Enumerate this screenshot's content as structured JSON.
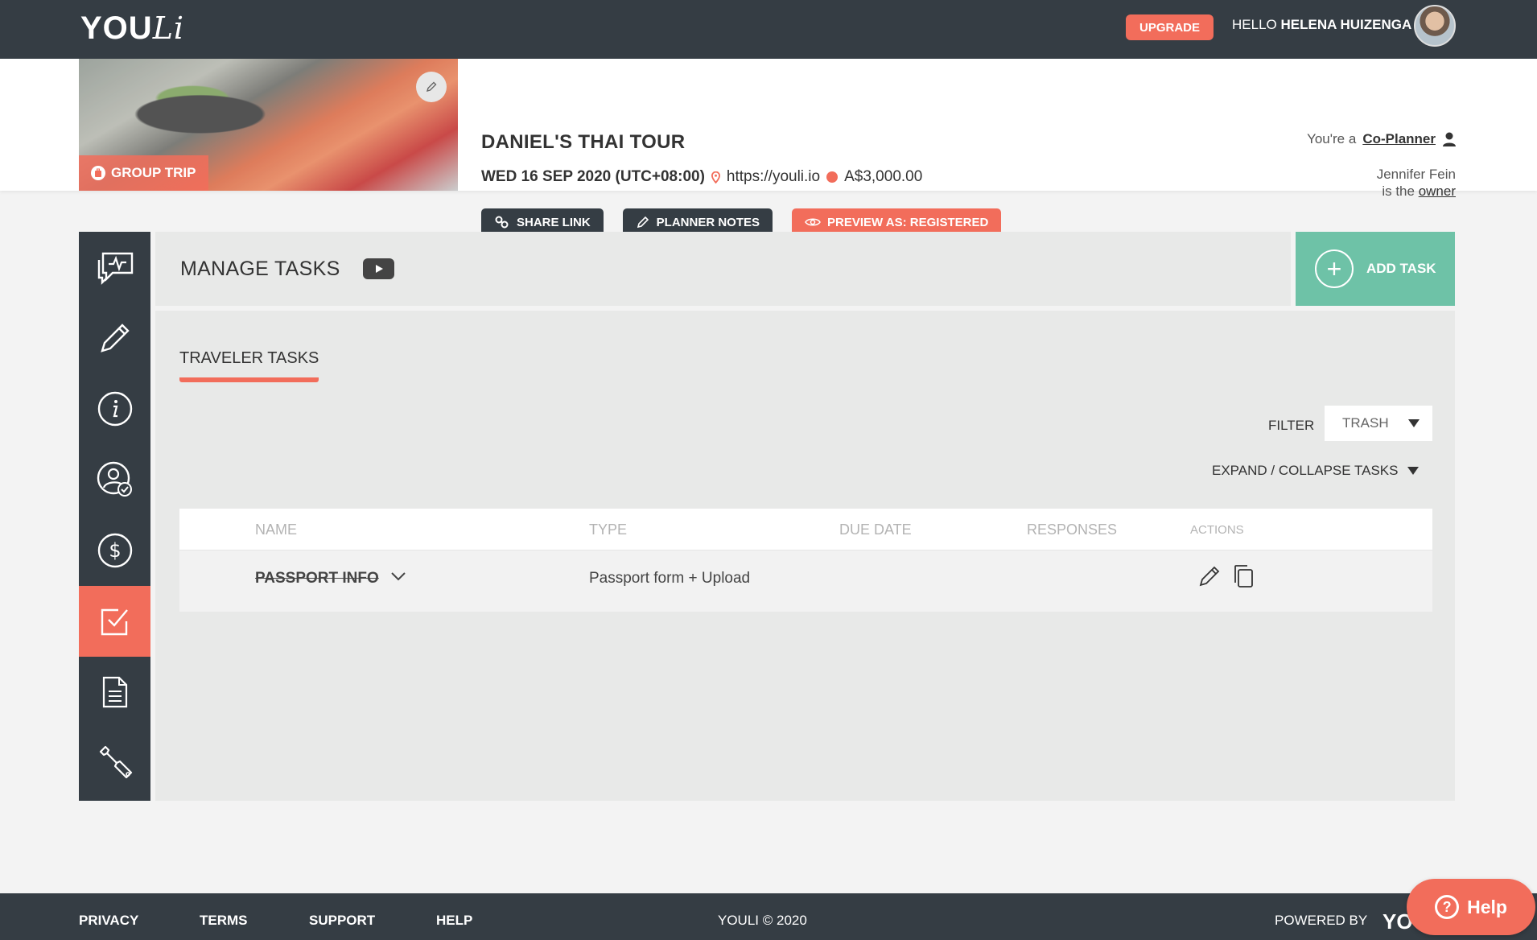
{
  "topbar": {
    "logo": {
      "main": "YOU",
      "script": "Li"
    },
    "upgrade_label": "UPGRADE",
    "hello_prefix": "HELLO",
    "user_name": "HELENA HUIZENGA"
  },
  "trip": {
    "badge": "GROUP TRIP",
    "title": "DANIEL'S THAI TOUR",
    "date": "WED 16 SEP 2020 (UTC+08:00)",
    "url": "https://youli.io",
    "price": "A$3,000.00",
    "actions": {
      "share": "SHARE LINK",
      "notes": "PLANNER NOTES",
      "preview": "PREVIEW AS: REGISTERED"
    },
    "role_prefix": "You're a",
    "role": "Co-Planner",
    "owner_name": "Jennifer Fein",
    "owner_prefix": "is the",
    "owner_role": "owner"
  },
  "sidebar": {
    "items": [
      {
        "icon": "activity-chat-icon"
      },
      {
        "icon": "pencil-icon"
      },
      {
        "icon": "info-icon"
      },
      {
        "icon": "user-check-icon"
      },
      {
        "icon": "dollar-icon"
      },
      {
        "icon": "checkbox-icon",
        "active": true
      },
      {
        "icon": "document-icon"
      },
      {
        "icon": "wrench-icon"
      }
    ]
  },
  "main": {
    "title": "MANAGE TASKS",
    "add_task_label": "ADD TASK",
    "tab_label": "TRAVELER TASKS",
    "filter_label": "FILTER",
    "filter_value": "TRASH",
    "expand_label": "EXPAND / COLLAPSE TASKS",
    "table": {
      "headers": {
        "name": "NAME",
        "type": "TYPE",
        "due": "DUE DATE",
        "responses": "RESPONSES",
        "actions": "ACTIONS"
      },
      "rows": [
        {
          "name": "PASSPORT INFO",
          "type": "Passport form + Upload",
          "due": "",
          "responses": ""
        }
      ]
    }
  },
  "footer": {
    "links": [
      "PRIVACY",
      "TERMS",
      "SUPPORT",
      "HELP"
    ],
    "copyright": "YOULI © 2020",
    "powered_by": "POWERED BY",
    "logo": "YO"
  },
  "help_button": "Help",
  "colors": {
    "accent": "#f26d5b",
    "dark": "#353d44",
    "green": "#6ec2a7"
  }
}
